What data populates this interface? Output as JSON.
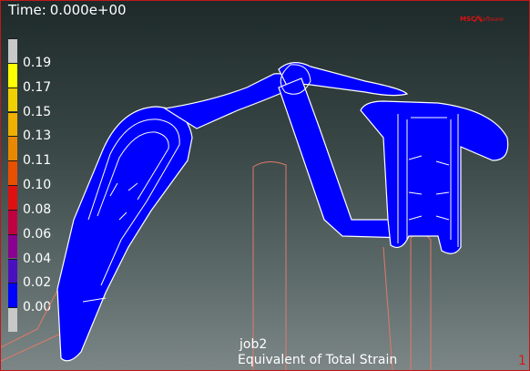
{
  "header": {
    "time_label": "Time:",
    "time_value": "0.000e+00"
  },
  "logo": {
    "brand": "MSC",
    "product": "Software",
    "color": "#e01010"
  },
  "legend": {
    "labels": [
      "0.19",
      "0.17",
      "0.15",
      "0.13",
      "0.11",
      "0.10",
      "0.08",
      "0.06",
      "0.04",
      "0.02",
      "0.00"
    ],
    "colors": [
      "#c8c8c8",
      "#ffff00",
      "#f0d000",
      "#f0b000",
      "#e88800",
      "#e85000",
      "#e01010",
      "#c00040",
      "#8a0090",
      "#4a10c0",
      "#0000ff",
      "#c8c8c8"
    ]
  },
  "footer": {
    "job_name": "job2",
    "result_variable": "Equivalent of Total Strain",
    "increment": "1"
  },
  "colors": {
    "mesh_fill": "#0000ff",
    "outline": "#ffffff",
    "rigid_contact": "#e07a6a",
    "frame": "#c01818"
  }
}
